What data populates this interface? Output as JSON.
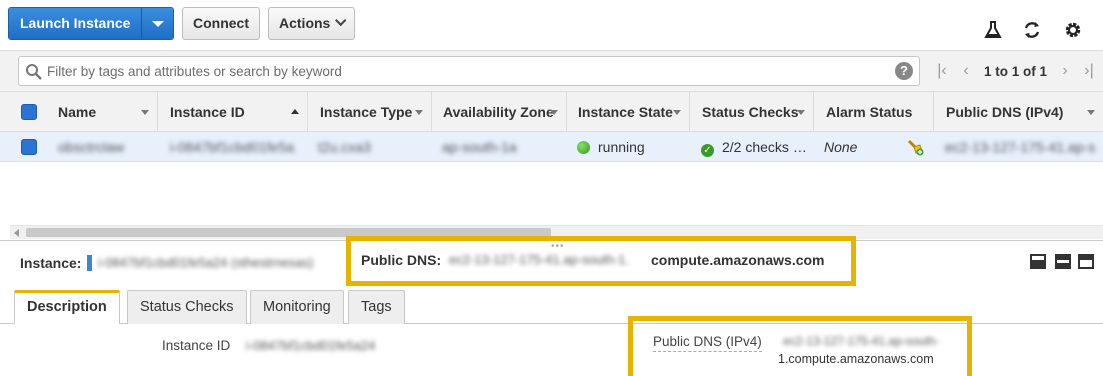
{
  "toolbar": {
    "launch_label": "Launch Instance",
    "connect_label": "Connect",
    "actions_label": "Actions"
  },
  "filter": {
    "placeholder": "Filter by tags and attributes or search by keyword",
    "help": "?",
    "pager": "1 to 1 of 1"
  },
  "columns": [
    "Name",
    "Instance ID",
    "Instance Type",
    "Availability Zone",
    "Instance State",
    "Status Checks",
    "Alarm Status",
    "Public DNS (IPv4)"
  ],
  "row": {
    "name": "obsctrclaw",
    "instance_id": "i-0847bf1cbd01fe5a24",
    "instance_type": "t2u.cxa3",
    "az": "ap-south-1a",
    "state": "running",
    "status_checks": "2/2 checks …",
    "alarm": "None",
    "dns": "ec2-13-127-175-41.ap-s"
  },
  "detail": {
    "instance_label": "Instance:",
    "instance_value": "i-0847bf1cbd01fe5a24 (sthestrnesas)",
    "public_dns_label": "Public DNS:",
    "public_dns_blurred": "ec2-13-127-175-41.ap-south-1.",
    "public_dns_suffix": "compute.amazonaws.com"
  },
  "tabs": [
    "Description",
    "Status Checks",
    "Monitoring",
    "Tags"
  ],
  "description": {
    "instance_id_label": "Instance ID",
    "instance_id_value": "i-0847bf1cbd01fe5a24",
    "public_dns_ipv4_label": "Public DNS (IPv4)",
    "public_dns_ipv4_blurred": "ec2-13-127-175-41.ap-south-",
    "public_dns_ipv4_suffix": "1.compute.amazonaws.com"
  },
  "colors": {
    "accent_blue": "#1e6fc7",
    "highlight": "#e8b300",
    "running_green": "#2c9a18"
  },
  "icons": [
    "flask-icon",
    "refresh-icon",
    "gear-icon",
    "search-icon",
    "help-icon",
    "first-page-icon",
    "prev-page-icon",
    "next-page-icon",
    "last-page-icon",
    "alarm-icon",
    "layout-icon"
  ]
}
